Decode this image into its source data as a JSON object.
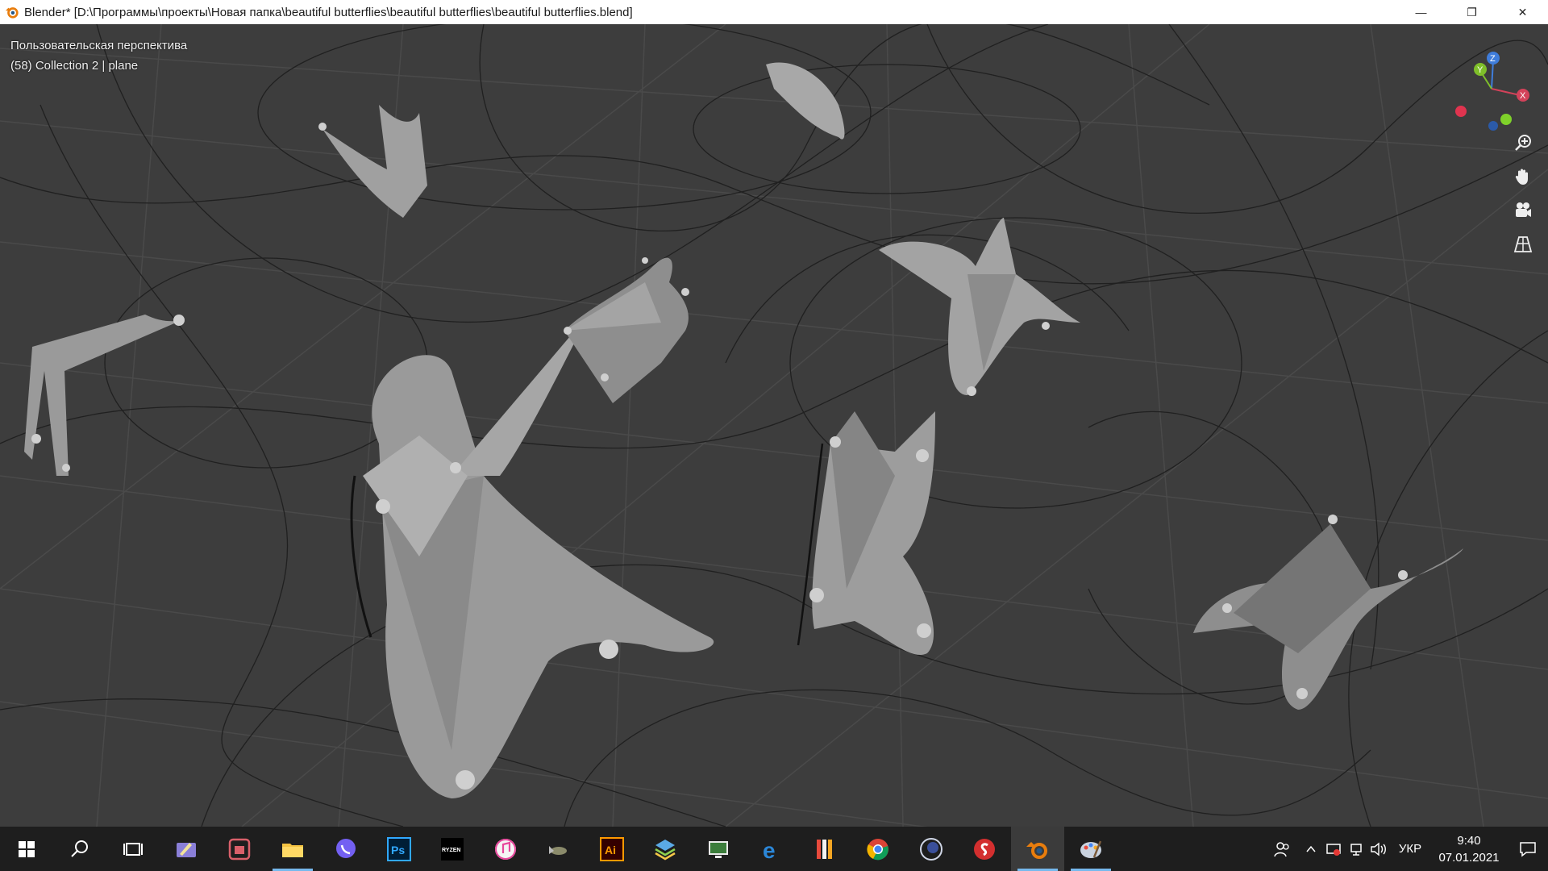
{
  "window": {
    "title": "Blender* [D:\\Программы\\проекты\\Новая папка\\beautiful butterflies\\beautiful butterflies\\beautiful butterflies.blend]",
    "controls": {
      "minimize": "—",
      "restore": "❐",
      "close": "✕"
    }
  },
  "viewport": {
    "view_name": "Пользовательская перспектива",
    "object_info": "(58) Collection 2 | plane",
    "background_color": "#3d3d3d",
    "gizmo_axes": {
      "x": "X",
      "y": "Y",
      "z": "Z"
    },
    "nav_tools": [
      "zoom-icon",
      "hand-pan-icon",
      "camera-icon",
      "grid-perspective-icon"
    ]
  },
  "taskbar": {
    "apps": [
      {
        "name": "windows-start",
        "label": ""
      },
      {
        "name": "search",
        "label": ""
      },
      {
        "name": "task-view",
        "label": ""
      },
      {
        "name": "app-1",
        "label": ""
      },
      {
        "name": "app-2",
        "label": ""
      },
      {
        "name": "file-explorer",
        "label": ""
      },
      {
        "name": "viber",
        "label": ""
      },
      {
        "name": "photoshop",
        "label": "Ps"
      },
      {
        "name": "ryzen-master",
        "label": "RYZEN"
      },
      {
        "name": "itunes",
        "label": ""
      },
      {
        "name": "app-3",
        "label": ""
      },
      {
        "name": "illustrator",
        "label": "Ai"
      },
      {
        "name": "layers-app",
        "label": ""
      },
      {
        "name": "app-4",
        "label": ""
      },
      {
        "name": "edge",
        "label": "e"
      },
      {
        "name": "app-5",
        "label": ""
      },
      {
        "name": "chrome",
        "label": ""
      },
      {
        "name": "cinema4d",
        "label": ""
      },
      {
        "name": "app-6",
        "label": ""
      },
      {
        "name": "blender",
        "label": ""
      },
      {
        "name": "app-7",
        "label": ""
      }
    ],
    "tray": {
      "language": "УКР",
      "time": "9:40",
      "date": "07.01.2021"
    }
  }
}
